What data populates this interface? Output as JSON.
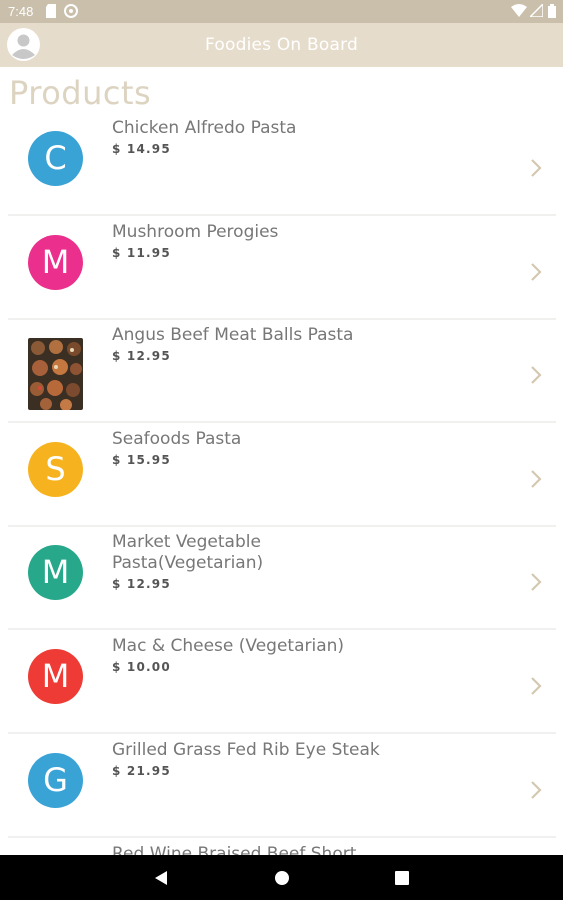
{
  "status_bar": {
    "time": "7:48"
  },
  "toolbar": {
    "title": "Foodies On Board"
  },
  "page": {
    "title": "Products"
  },
  "products": [
    {
      "name": "Chicken Alfredo Pasta",
      "price": "$ 14.95",
      "letter": "C",
      "color": "#3aa3d6",
      "image": false
    },
    {
      "name": "Mushroom Perogies",
      "price": "$ 11.95",
      "letter": "M",
      "color": "#ea2f8c",
      "image": false
    },
    {
      "name": "Angus Beef Meat Balls Pasta",
      "price": "$ 12.95",
      "letter": "",
      "color": "",
      "image": true
    },
    {
      "name": "Seafoods Pasta",
      "price": "$ 15.95",
      "letter": "S",
      "color": "#f6b31f",
      "image": false
    },
    {
      "name": "Market Vegetable Pasta(Vegetarian)",
      "price": "$ 12.95",
      "letter": "M",
      "color": "#27a88a",
      "image": false
    },
    {
      "name": "Mac & Cheese (Vegetarian)",
      "price": "$ 10.00",
      "letter": "M",
      "color": "#ee3b35",
      "image": false
    },
    {
      "name": "Grilled Grass Fed Rib Eye Steak",
      "price": "$ 21.95",
      "letter": "G",
      "color": "#3aa3d6",
      "image": false
    },
    {
      "name": "Red Wine Braised Beef Short",
      "price": "",
      "letter": "",
      "color": "",
      "image": true
    }
  ],
  "colors": {
    "accent": "#e6dccb",
    "chevron": "#d4c8b0",
    "status_bar": "#c9bfab"
  }
}
